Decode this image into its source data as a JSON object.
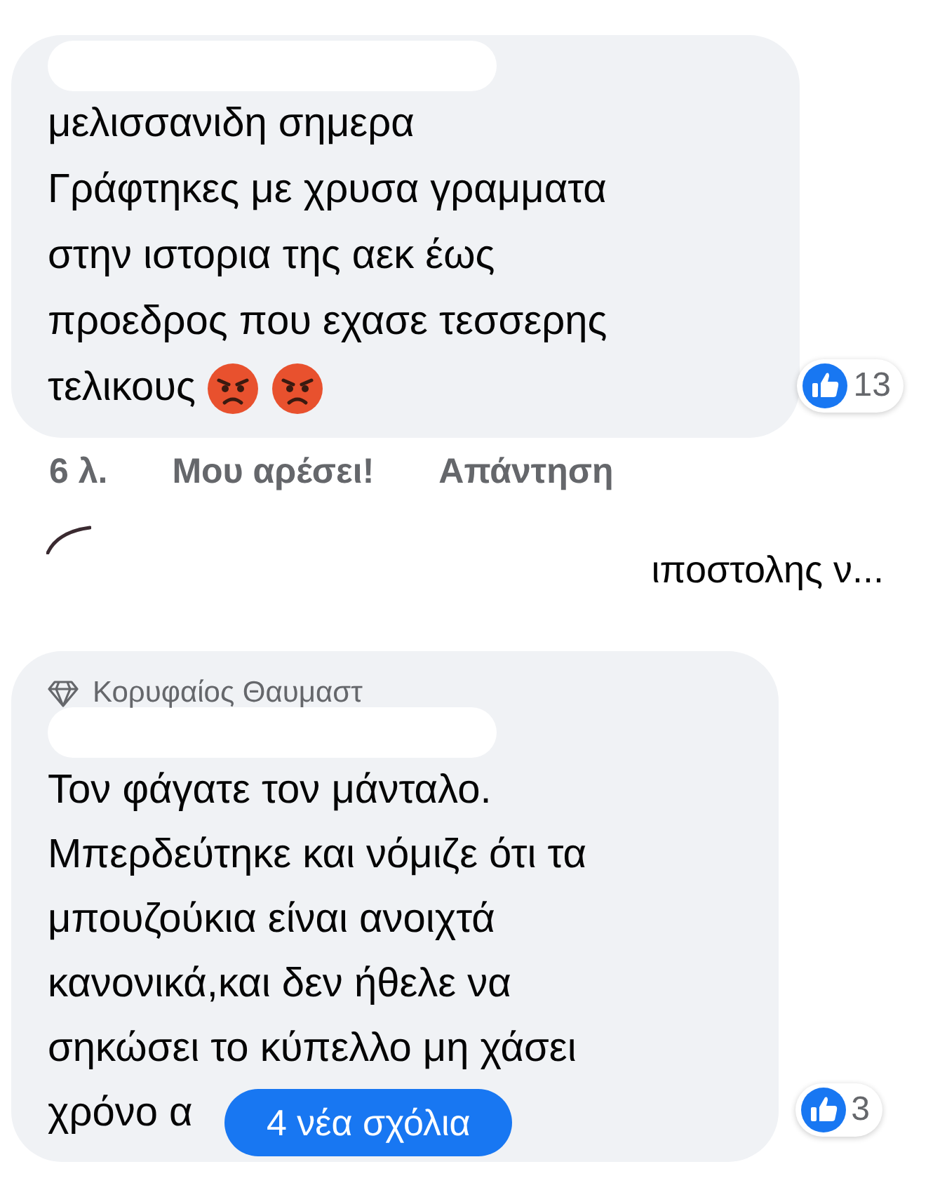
{
  "comments": [
    {
      "lines": [
        "μελισσανιδη σημερα",
        "Γράφτηκες με χρυσα γραμματα",
        "στην ιστορια της αεκ έως",
        "προεδρος που εχασε τεσσερης",
        "τελικους"
      ],
      "reactions": "13",
      "footer": {
        "time": "6 λ.",
        "like": "Μου αρέσει!",
        "reply": "Απάντηση"
      }
    },
    {
      "badge": "Κορυφαίος Θαυμαστ",
      "lines": [
        "Τον φάγατε τον μάνταλο.",
        "Μπερδεύτηκε και νόμιζε ότι τα",
        "μπουζούκια είναι ανοιχτά",
        "κανονικά,και δεν ήθελε να",
        "σηκώσει το κύπελλο μη χάσει",
        "χρόνο α"
      ],
      "reactions": "3"
    }
  ],
  "reply_preview": "ιποστολης ν...",
  "new_comments_button": "4 νέα σχόλια"
}
